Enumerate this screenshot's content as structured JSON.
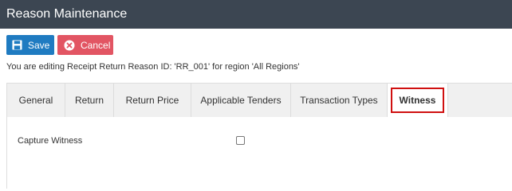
{
  "window": {
    "title": "Reason Maintenance"
  },
  "toolbar": {
    "save_label": "Save",
    "save_icon": "floppy-disk-icon",
    "cancel_label": "Cancel",
    "cancel_icon": "x-circle-icon",
    "save_color": "#1f7bc1",
    "cancel_color": "#e25563"
  },
  "info_text": "You are editing Receipt Return Reason ID: 'RR_001' for region 'All Regions'",
  "tabs": [
    {
      "label": "General"
    },
    {
      "label": "Return"
    },
    {
      "label": "Return Price"
    },
    {
      "label": "Applicable Tenders"
    },
    {
      "label": "Transaction Types"
    },
    {
      "label": "Witness",
      "active": true
    }
  ],
  "witness_tab": {
    "capture_witness_label": "Capture Witness",
    "capture_witness_checked": false
  },
  "colors": {
    "titlebar": "#3c4652",
    "highlight": "#d01010"
  }
}
